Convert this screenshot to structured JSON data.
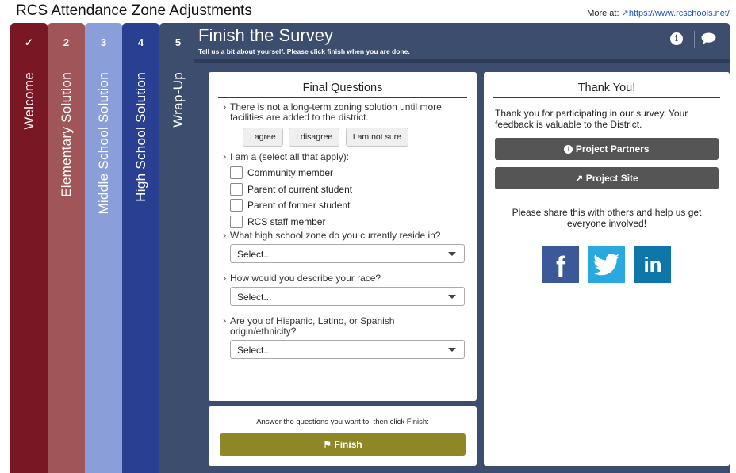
{
  "page": {
    "title": "RCS Attendance Zone Adjustments",
    "more_at_label": "More at:",
    "more_at_link": "https://www.rcschools.net/"
  },
  "tabs": [
    {
      "num": "✓",
      "label": "Welcome",
      "color": "#7a1725"
    },
    {
      "num": "2",
      "label": "Elementary Solution",
      "color": "#a05558"
    },
    {
      "num": "3",
      "label": "Middle School Solution",
      "color": "#8a9fd9"
    },
    {
      "num": "4",
      "label": "High School Solution",
      "color": "#293f92"
    },
    {
      "num": "5",
      "label": "Wrap-Up",
      "color": "#3d4d6e"
    }
  ],
  "header": {
    "title": "Finish the Survey",
    "subtitle": "Tell us a bit about yourself. Please click finish when you are done."
  },
  "final_questions": {
    "title": "Final Questions",
    "q1": "There is not a long-term zoning solution until more facilities are added to the district.",
    "q1_options": [
      "I agree",
      "I disagree",
      "I am not sure"
    ],
    "q2": "I am a (select all that apply):",
    "q2_options": [
      "Community member",
      "Parent of current student",
      "Parent of former student",
      "RCS staff member"
    ],
    "q3": "What high school zone do you currently reside in?",
    "q3_value": "Select...",
    "q4": "How would you describe your race?",
    "q4_value": "Select...",
    "q5": "Are you of Hispanic, Latino, or Spanish origin/ethnicity?",
    "q5_value": "Select..."
  },
  "finish_panel": {
    "note": "Answer the questions you want to, then click Finish:",
    "button": "Finish"
  },
  "thank_you": {
    "title": "Thank You!",
    "text": "Thank you for participating in our survey. Your feedback is valuable to the District.",
    "partners_button": "Project Partners",
    "site_button": "Project Site",
    "share_text": "Please share this with others and help us get everyone involved!"
  },
  "social": {
    "facebook_color": "#3b5998",
    "twitter_color": "#2aa9e0",
    "linkedin_color": "#0e76a8",
    "facebook_glyph": "f",
    "linkedin_glyph": "in"
  },
  "colors": {
    "header_bg": "#3d4d6e",
    "finish_button": "#8e8727",
    "dark_button": "#555555"
  }
}
